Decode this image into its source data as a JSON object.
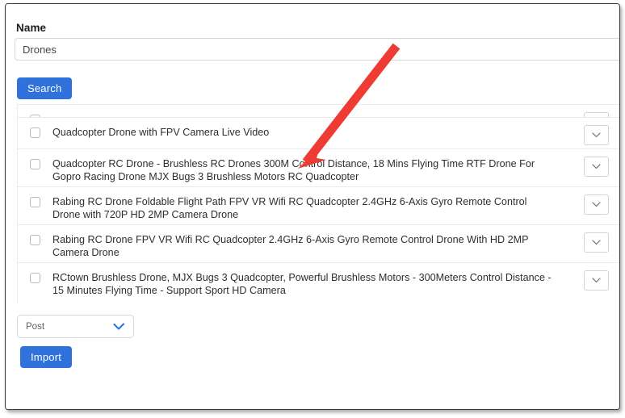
{
  "form": {
    "name_label": "Name",
    "name_value": "Drones",
    "name_placeholder": "Name",
    "search_label": "Search"
  },
  "results": {
    "rows": [
      {
        "title": "",
        "partial": true,
        "lines": 0
      },
      {
        "title": "Quadcopter Drone with FPV Camera Live Video",
        "partial": false,
        "lines": 1
      },
      {
        "title": "Quadcopter RC Drone - Brushless RC Drones 300M Control Distance, 18 Mins Flying Time RTF Drone For Gopro Racing Drone MJX Bugs 3 Brushless Motors RC Quadcopter",
        "partial": false,
        "lines": 2
      },
      {
        "title": "Rabing RC Drone Foldable Flight Path FPV VR Wifi RC Quadcopter 2.4GHz 6-Axis Gyro Remote Control Drone with 720P HD 2MP Camera Drone",
        "partial": false,
        "lines": 2
      },
      {
        "title": "Rabing RC Drone FPV VR Wifi RC Quadcopter 2.4GHz 6-Axis Gyro Remote Control Drone With HD 2MP Camera Drone",
        "partial": false,
        "lines": 2
      },
      {
        "title": "RCtown Brushless Drone, MJX Bugs 3 Quadcopter, Powerful Brushless Motors - 300Meters Control Distance - 15 Minutes Flying Time - Support Sport HD Camera",
        "partial": false,
        "lines": 2
      }
    ],
    "expand_icon": "chevron-down-icon",
    "checkbox_icon": "checkbox-unchecked-icon"
  },
  "footer": {
    "post_type_value": "Post",
    "post_type_caret_icon": "chevron-down-icon",
    "import_label": "Import"
  },
  "annotation": {
    "arrow_icon": "red-arrow-down-left",
    "arrow_color": "#ee3b33"
  },
  "colors": {
    "primary_button": "#2f72db",
    "border": "#d4d7dc",
    "row_divider": "#e9eaec",
    "text": "#2b2f33",
    "accent_red": "#ee3b33",
    "caret_blue": "#2f72db"
  }
}
